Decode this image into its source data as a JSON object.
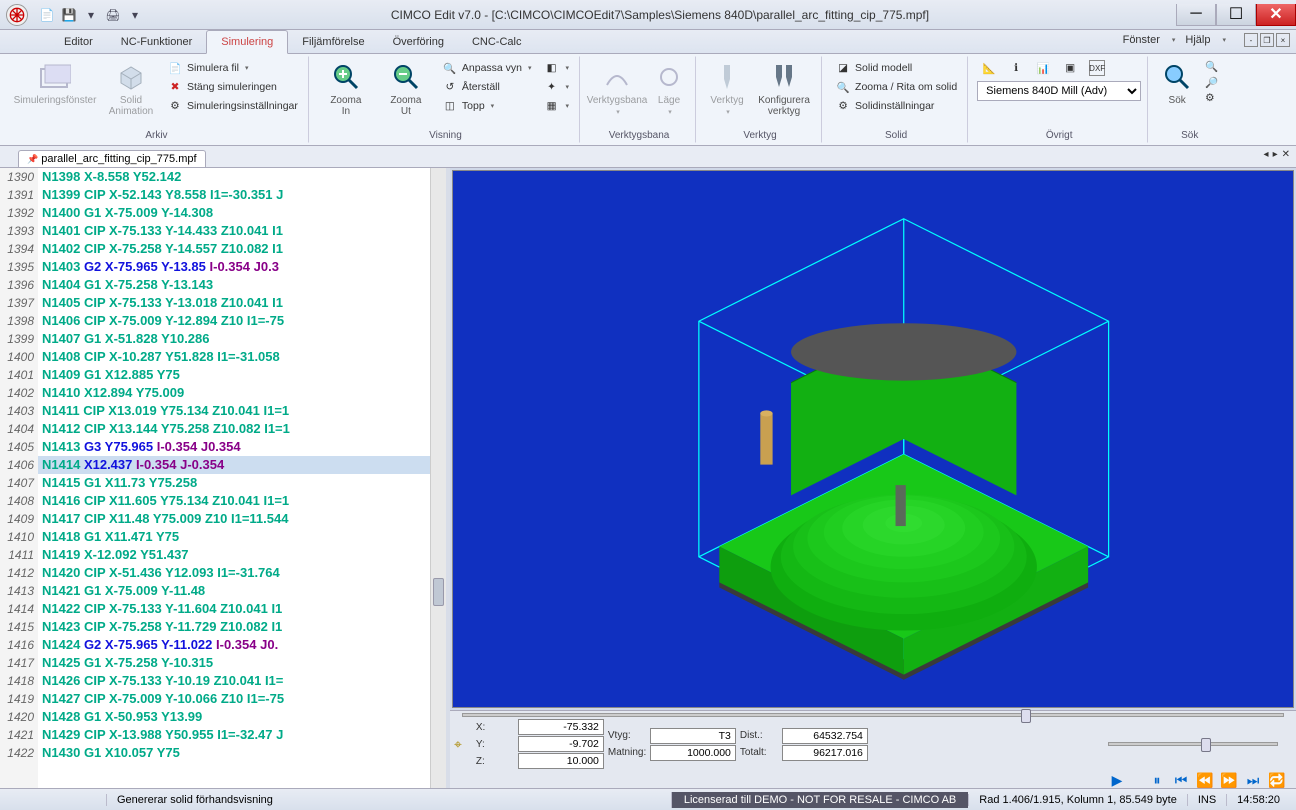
{
  "title": "CIMCO Edit v7.0 - [C:\\CIMCO\\CIMCOEdit7\\Samples\\Siemens 840D\\parallel_arc_fitting_cip_775.mpf]",
  "qat": [
    "new",
    "save",
    "sep",
    "print"
  ],
  "menu_right": {
    "fonster": "Fönster",
    "hjalp": "Hjälp"
  },
  "tabs": [
    "Editor",
    "NC-Funktioner",
    "Simulering",
    "Filjämförelse",
    "Överföring",
    "CNC-Calc"
  ],
  "active_tab": 2,
  "ribbon": {
    "arkiv": {
      "title": "Arkiv",
      "simuleringsfonster": "Simuleringsfönster",
      "solid_anim": "Solid\nAnimation",
      "simulera_fil": "Simulera fil",
      "stang": "Stäng simuleringen",
      "installningar": "Simuleringsinställningar"
    },
    "visning": {
      "title": "Visning",
      "zoomin": "Zooma\nIn",
      "zoomut": "Zooma\nUt",
      "anpassa": "Anpassa vyn",
      "aterstall": "Återställ",
      "topp": "Topp"
    },
    "verktygsbana": {
      "title": "Verktygsbana",
      "verktygsbana": "Verktygsbana",
      "lage": "Läge"
    },
    "verktyg": {
      "title": "Verktyg",
      "verktyg": "Verktyg",
      "konfig": "Konfigurera\nverktyg"
    },
    "solid": {
      "title": "Solid",
      "modell": "Solid modell",
      "zooma": "Zooma / Rita om solid",
      "inst": "Solidinställningar"
    },
    "ovrigt": {
      "title": "Övrigt",
      "machine": "Siemens 840D Mill (Adv)"
    },
    "sok": {
      "title": "Sök",
      "sok": "Sök"
    }
  },
  "doctab": "parallel_arc_fitting_cip_775.mpf",
  "code_lines": [
    {
      "ln": 1390,
      "t": "N1398 X-8.558 Y52.142",
      "c": "g"
    },
    {
      "ln": 1391,
      "t": "N1399 CIP X-52.143 Y8.558 I1=-30.351 J",
      "c": "g"
    },
    {
      "ln": 1392,
      "t": "N1400 G1 X-75.009 Y-14.308",
      "c": "g"
    },
    {
      "ln": 1393,
      "t": "N1401 CIP X-75.133 Y-14.433 Z10.041 I1",
      "c": "g"
    },
    {
      "ln": 1394,
      "t": "N1402 CIP X-75.258 Y-14.557 Z10.082 I1",
      "c": "g"
    },
    {
      "ln": 1395,
      "t": "N1403 G2 X-75.965 Y-13.85 I-0.354 J0.3",
      "c": "b"
    },
    {
      "ln": 1396,
      "t": "N1404 G1 X-75.258 Y-13.143",
      "c": "g"
    },
    {
      "ln": 1397,
      "t": "N1405 CIP X-75.133 Y-13.018 Z10.041 I1",
      "c": "g"
    },
    {
      "ln": 1398,
      "t": "N1406 CIP X-75.009 Y-12.894 Z10 I1=-75",
      "c": "g"
    },
    {
      "ln": 1399,
      "t": "N1407 G1 X-51.828 Y10.286",
      "c": "g"
    },
    {
      "ln": 1400,
      "t": "N1408 CIP X-10.287 Y51.828 I1=-31.058",
      "c": "g"
    },
    {
      "ln": 1401,
      "t": "N1409 G1 X12.885 Y75",
      "c": "g"
    },
    {
      "ln": 1402,
      "t": "N1410 X12.894 Y75.009",
      "c": "g"
    },
    {
      "ln": 1403,
      "t": "N1411 CIP X13.019 Y75.134 Z10.041 I1=1",
      "c": "g"
    },
    {
      "ln": 1404,
      "t": "N1412 CIP X13.144 Y75.258 Z10.082 I1=1",
      "c": "g"
    },
    {
      "ln": 1405,
      "t": "N1413 G3 Y75.965 I-0.354 J0.354",
      "c": "b"
    },
    {
      "ln": 1406,
      "t": "N1414 X12.437 I-0.354 J-0.354",
      "c": "b",
      "sel": true
    },
    {
      "ln": 1407,
      "t": "N1415 G1 X11.73 Y75.258",
      "c": "g"
    },
    {
      "ln": 1408,
      "t": "N1416 CIP X11.605 Y75.134 Z10.041 I1=1",
      "c": "g"
    },
    {
      "ln": 1409,
      "t": "N1417 CIP X11.48 Y75.009 Z10 I1=11.544",
      "c": "g"
    },
    {
      "ln": 1410,
      "t": "N1418 G1 X11.471 Y75",
      "c": "g"
    },
    {
      "ln": 1411,
      "t": "N1419 X-12.092 Y51.437",
      "c": "g"
    },
    {
      "ln": 1412,
      "t": "N1420 CIP X-51.436 Y12.093 I1=-31.764",
      "c": "g"
    },
    {
      "ln": 1413,
      "t": "N1421 G1 X-75.009 Y-11.48",
      "c": "g"
    },
    {
      "ln": 1414,
      "t": "N1422 CIP X-75.133 Y-11.604 Z10.041 I1",
      "c": "g"
    },
    {
      "ln": 1415,
      "t": "N1423 CIP X-75.258 Y-11.729 Z10.082 I1",
      "c": "g"
    },
    {
      "ln": 1416,
      "t": "N1424 G2 X-75.965 Y-11.022 I-0.354 J0.",
      "c": "b"
    },
    {
      "ln": 1417,
      "t": "N1425 G1 X-75.258 Y-10.315",
      "c": "g"
    },
    {
      "ln": 1418,
      "t": "N1426 CIP X-75.133 Y-10.19 Z10.041 I1=",
      "c": "g"
    },
    {
      "ln": 1419,
      "t": "N1427 CIP X-75.009 Y-10.066 Z10 I1=-75",
      "c": "g"
    },
    {
      "ln": 1420,
      "t": "N1428 G1 X-50.953 Y13.99",
      "c": "g"
    },
    {
      "ln": 1421,
      "t": "N1429 CIP X-13.988 Y50.955 I1=-32.47 J",
      "c": "g"
    },
    {
      "ln": 1422,
      "t": "N1430 G1 X10.057 Y75",
      "c": "g"
    }
  ],
  "readouts": {
    "x": {
      "l": "X:",
      "v": "-75.332"
    },
    "y": {
      "l": "Y:",
      "v": "-9.702"
    },
    "z": {
      "l": "Z:",
      "v": "10.000"
    },
    "vtg": {
      "l": "Vtyg:",
      "v": "T3"
    },
    "matn": {
      "l": "Matning:",
      "v": "1000.000"
    },
    "dist": {
      "l": "Dist.:",
      "v": "64532.754"
    },
    "totalt": {
      "l": "Totalt:",
      "v": "96217.016"
    }
  },
  "status": {
    "gen": "Genererar solid förhandsvisning",
    "lic": "Licenserad till DEMO - NOT FOR RESALE - CIMCO AB",
    "pos": "Rad 1.406/1.915, Kolumn 1, 85.549 byte",
    "ins": "INS",
    "time": "14:58:20"
  }
}
